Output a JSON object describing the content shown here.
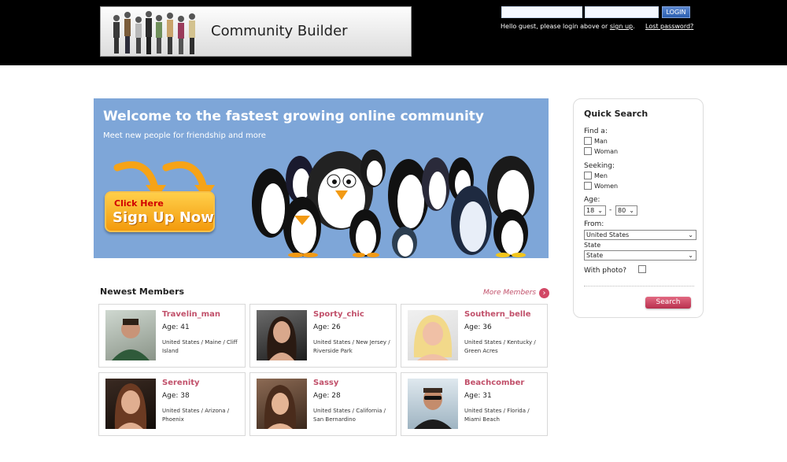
{
  "header": {
    "site_title": "Community Builder",
    "login_label": "LOGIN",
    "guest_msg_prefix": "Hello guest, please login above or ",
    "signup_link": "sign up",
    "guest_msg_suffix": ".",
    "lost_password": "Lost password?"
  },
  "banner": {
    "title": "Welcome to the fastest growing online community",
    "subtitle": "Meet new people for friendship and more",
    "button_top": "Click Here",
    "button_main": "Sign Up Now"
  },
  "newest_members": {
    "title": "Newest Members",
    "more_label": "More Members",
    "members": [
      {
        "name": "Travelin_man",
        "age": "Age: 41",
        "location": "United States / Maine / Cliff Island"
      },
      {
        "name": "Sporty_chic",
        "age": "Age: 26",
        "location": "United States / New Jersey / Riverside Park"
      },
      {
        "name": "Southern_belle",
        "age": "Age: 36",
        "location": "United States / Kentucky / Green Acres"
      },
      {
        "name": "Serenity",
        "age": "Age: 38",
        "location": "United States / Arizona / Phoenix"
      },
      {
        "name": "Sassy",
        "age": "Age: 28",
        "location": "United States / California / San Bernardino"
      },
      {
        "name": "Beachcomber",
        "age": "Age: 31",
        "location": "United States / Florida / Miami Beach"
      }
    ]
  },
  "quick_search": {
    "title": "Quick Search",
    "find_label": "Find a:",
    "find_options": [
      "Man",
      "Woman"
    ],
    "seeking_label": "Seeking:",
    "seeking_options": [
      "Men",
      "Women"
    ],
    "age_label": "Age:",
    "age_min": "18",
    "age_sep": "-",
    "age_max": "80",
    "from_label": "From:",
    "country": "United States",
    "state_label": "State",
    "state": "State",
    "photo_label": "With photo?",
    "search_button": "Search"
  },
  "colors": {
    "accent": "#c1506a",
    "banner_bg": "#7ea6d8",
    "header_bg": "#000000"
  }
}
